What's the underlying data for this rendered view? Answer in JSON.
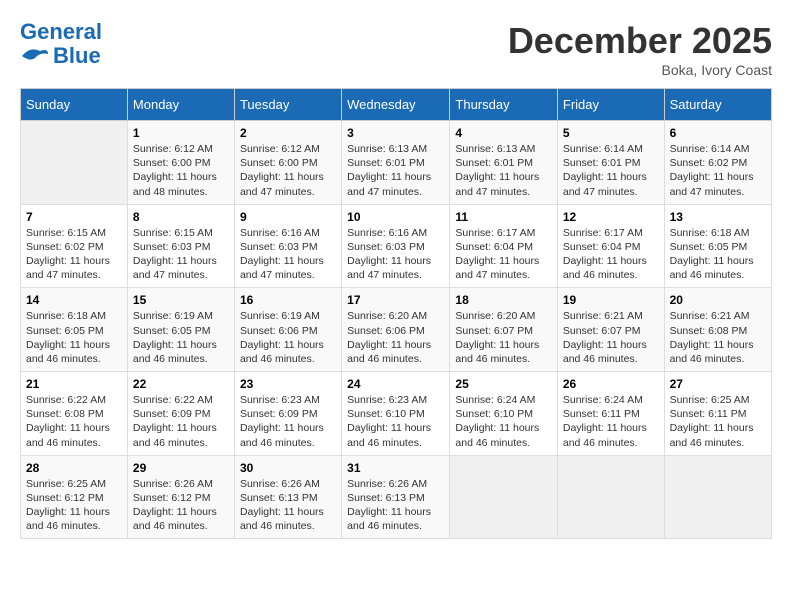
{
  "header": {
    "logo_line1": "General",
    "logo_line2": "Blue",
    "month": "December 2025",
    "location": "Boka, Ivory Coast"
  },
  "days_of_week": [
    "Sunday",
    "Monday",
    "Tuesday",
    "Wednesday",
    "Thursday",
    "Friday",
    "Saturday"
  ],
  "weeks": [
    [
      {
        "day": "",
        "info": ""
      },
      {
        "day": "1",
        "info": "Sunrise: 6:12 AM\nSunset: 6:00 PM\nDaylight: 11 hours\nand 48 minutes."
      },
      {
        "day": "2",
        "info": "Sunrise: 6:12 AM\nSunset: 6:00 PM\nDaylight: 11 hours\nand 47 minutes."
      },
      {
        "day": "3",
        "info": "Sunrise: 6:13 AM\nSunset: 6:01 PM\nDaylight: 11 hours\nand 47 minutes."
      },
      {
        "day": "4",
        "info": "Sunrise: 6:13 AM\nSunset: 6:01 PM\nDaylight: 11 hours\nand 47 minutes."
      },
      {
        "day": "5",
        "info": "Sunrise: 6:14 AM\nSunset: 6:01 PM\nDaylight: 11 hours\nand 47 minutes."
      },
      {
        "day": "6",
        "info": "Sunrise: 6:14 AM\nSunset: 6:02 PM\nDaylight: 11 hours\nand 47 minutes."
      }
    ],
    [
      {
        "day": "7",
        "info": "Sunrise: 6:15 AM\nSunset: 6:02 PM\nDaylight: 11 hours\nand 47 minutes."
      },
      {
        "day": "8",
        "info": "Sunrise: 6:15 AM\nSunset: 6:03 PM\nDaylight: 11 hours\nand 47 minutes."
      },
      {
        "day": "9",
        "info": "Sunrise: 6:16 AM\nSunset: 6:03 PM\nDaylight: 11 hours\nand 47 minutes."
      },
      {
        "day": "10",
        "info": "Sunrise: 6:16 AM\nSunset: 6:03 PM\nDaylight: 11 hours\nand 47 minutes."
      },
      {
        "day": "11",
        "info": "Sunrise: 6:17 AM\nSunset: 6:04 PM\nDaylight: 11 hours\nand 47 minutes."
      },
      {
        "day": "12",
        "info": "Sunrise: 6:17 AM\nSunset: 6:04 PM\nDaylight: 11 hours\nand 46 minutes."
      },
      {
        "day": "13",
        "info": "Sunrise: 6:18 AM\nSunset: 6:05 PM\nDaylight: 11 hours\nand 46 minutes."
      }
    ],
    [
      {
        "day": "14",
        "info": "Sunrise: 6:18 AM\nSunset: 6:05 PM\nDaylight: 11 hours\nand 46 minutes."
      },
      {
        "day": "15",
        "info": "Sunrise: 6:19 AM\nSunset: 6:05 PM\nDaylight: 11 hours\nand 46 minutes."
      },
      {
        "day": "16",
        "info": "Sunrise: 6:19 AM\nSunset: 6:06 PM\nDaylight: 11 hours\nand 46 minutes."
      },
      {
        "day": "17",
        "info": "Sunrise: 6:20 AM\nSunset: 6:06 PM\nDaylight: 11 hours\nand 46 minutes."
      },
      {
        "day": "18",
        "info": "Sunrise: 6:20 AM\nSunset: 6:07 PM\nDaylight: 11 hours\nand 46 minutes."
      },
      {
        "day": "19",
        "info": "Sunrise: 6:21 AM\nSunset: 6:07 PM\nDaylight: 11 hours\nand 46 minutes."
      },
      {
        "day": "20",
        "info": "Sunrise: 6:21 AM\nSunset: 6:08 PM\nDaylight: 11 hours\nand 46 minutes."
      }
    ],
    [
      {
        "day": "21",
        "info": "Sunrise: 6:22 AM\nSunset: 6:08 PM\nDaylight: 11 hours\nand 46 minutes."
      },
      {
        "day": "22",
        "info": "Sunrise: 6:22 AM\nSunset: 6:09 PM\nDaylight: 11 hours\nand 46 minutes."
      },
      {
        "day": "23",
        "info": "Sunrise: 6:23 AM\nSunset: 6:09 PM\nDaylight: 11 hours\nand 46 minutes."
      },
      {
        "day": "24",
        "info": "Sunrise: 6:23 AM\nSunset: 6:10 PM\nDaylight: 11 hours\nand 46 minutes."
      },
      {
        "day": "25",
        "info": "Sunrise: 6:24 AM\nSunset: 6:10 PM\nDaylight: 11 hours\nand 46 minutes."
      },
      {
        "day": "26",
        "info": "Sunrise: 6:24 AM\nSunset: 6:11 PM\nDaylight: 11 hours\nand 46 minutes."
      },
      {
        "day": "27",
        "info": "Sunrise: 6:25 AM\nSunset: 6:11 PM\nDaylight: 11 hours\nand 46 minutes."
      }
    ],
    [
      {
        "day": "28",
        "info": "Sunrise: 6:25 AM\nSunset: 6:12 PM\nDaylight: 11 hours\nand 46 minutes."
      },
      {
        "day": "29",
        "info": "Sunrise: 6:26 AM\nSunset: 6:12 PM\nDaylight: 11 hours\nand 46 minutes."
      },
      {
        "day": "30",
        "info": "Sunrise: 6:26 AM\nSunset: 6:13 PM\nDaylight: 11 hours\nand 46 minutes."
      },
      {
        "day": "31",
        "info": "Sunrise: 6:26 AM\nSunset: 6:13 PM\nDaylight: 11 hours\nand 46 minutes."
      },
      {
        "day": "",
        "info": ""
      },
      {
        "day": "",
        "info": ""
      },
      {
        "day": "",
        "info": ""
      }
    ]
  ]
}
